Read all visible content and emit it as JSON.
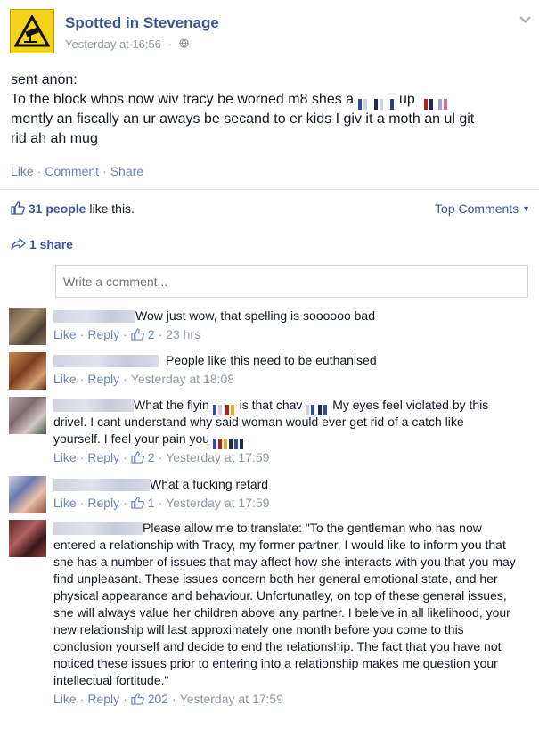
{
  "post": {
    "page_name": "Spotted in Stevenage",
    "timestamp": "Yesterday at 16:56",
    "audience_icon": "globe-icon",
    "logo_icon": "cctv-warning-sign-icon",
    "text_line1": "sent anon:",
    "text_line2a": "To the block whos now wiv tracy be worned m8 shes a",
    "text_line2b": "up",
    "text_line3": "mently an fiscally an ur aways be secand to er kids I giv it a moth an ul git",
    "text_line4": "rid ah ah mug",
    "actions": {
      "like": "Like",
      "comment": "Comment",
      "share": "Share"
    }
  },
  "likes": {
    "count": "31 people",
    "suffix": "like this."
  },
  "top_comments": "Top Comments",
  "shares": "1 share",
  "comment_input": {
    "placeholder": "Write a comment..."
  },
  "comments": [
    {
      "text": "Wow just wow, that spelling is soooooo bad",
      "likes": "2",
      "time": "23 hrs",
      "like": "Like",
      "reply": "Reply"
    },
    {
      "text": "People like this need to be euthanised",
      "likes": "",
      "time": "Yesterday at 18:08",
      "like": "Like",
      "reply": "Reply"
    },
    {
      "text_a": "What the flyin",
      "text_b": "is that chav",
      "text_c": "My eyes feel violated by this drivel. I cant understand why said woman would ever get rid of a catch like yourself. I feel your pain you",
      "likes": "2",
      "time": "Yesterday at 17:59",
      "like": "Like",
      "reply": "Reply"
    },
    {
      "text": "What a fucking retard",
      "likes": "1",
      "time": "Yesterday at 17:59",
      "like": "Like",
      "reply": "Reply"
    },
    {
      "text": "Please allow me to translate: \"To the gentleman who has now entered a relationship with Tracy, my former partner, I would like to inform you that she has a number of issues that may affect how she interacts with you that you may find unpleasant. These issues concern both her general emotional state, and her physical appearance and behaviour. Unfortunatley, on top of these general issues, she will always value her children above any partner. I beleive in all likelihood, your new relationship will last approximately one month before you come to this conclusion yourself and decide to end the relationship. The fact that you have not noticed these issues prior to entering into a relationship makes me question your intellectual fortitude.\"",
      "likes": "202",
      "time": "Yesterday at 17:59",
      "like": "Like",
      "reply": "Reply"
    }
  ]
}
